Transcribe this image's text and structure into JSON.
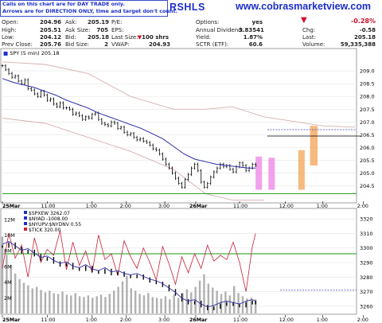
{
  "callout": {
    "line1": "Calls on this chart are for DAY TRADE only.",
    "line2": "Arrows are for DIRECTION ONLY, time and target don't count."
  },
  "ticker": "RSHLS",
  "site": "www.cobrasmarketview.com",
  "quote": {
    "open_label": "Open:",
    "open": "204.96",
    "high_label": "High:",
    "high": "205.51",
    "low_label": "Low:",
    "low": "204.12",
    "prev_label": "Prev Close:",
    "prev": "205.76",
    "ask_label": "Ask:",
    "ask": "205.19",
    "asksize_label": "Ask Size:",
    "asksize": "705",
    "bid_label": "Bid:",
    "bid": "205.18",
    "bidsize_label": "Bid Size:",
    "bidsize": "2",
    "pe_label": "P/E:",
    "eps_label": "EPS:",
    "lastsize_label": "Last Size:",
    "lastsize": "100 shrs",
    "vwap_label": "VWAP:",
    "vwap": "204.93",
    "options_label": "Options:",
    "options": "yes",
    "annualdiv_label": "Annual Dividend:",
    "annualdiv": "3.83541",
    "yield_label": "Yield:",
    "yield": "1.87%",
    "sctr_label": "SCTR (ETF):",
    "sctr": "60.6",
    "changepct": "-0.28%",
    "chg_label": "Chg:",
    "chg": "-0.58",
    "last_label": "Last:",
    "last": "205.18",
    "volume_label": "Volume:",
    "volume": "59,335,388"
  },
  "colors": {
    "price_bar": "#000000",
    "ma_line": "#2c2ca8",
    "envelope": "#d6b0b0",
    "pink_box": "#ee82e6",
    "orange_box": "#f4a860",
    "support": "#1a9a1a",
    "tick_line": "#c8203a",
    "volume_bar": "#b0b0b0",
    "dashed": "#4040c0",
    "brand_blue": "#1d2ec9",
    "down_red": "#d0102a"
  },
  "chart_data": [
    {
      "type": "line",
      "title": "SPY (5 min) 205.18",
      "series": [
        {
          "name": "SPY (5 min) 205.18",
          "x": [
            0,
            3,
            6,
            9,
            12,
            15,
            18,
            21,
            24,
            27,
            30,
            33,
            36,
            39,
            42,
            45,
            48,
            51,
            54,
            57,
            60,
            63,
            66,
            69,
            72,
            75,
            78,
            81,
            84,
            87,
            90,
            93,
            96,
            99,
            102,
            105,
            108,
            111,
            114,
            117,
            120,
            123,
            126,
            129,
            132,
            135,
            138,
            141,
            144,
            147,
            150,
            153,
            156,
            159,
            162,
            165,
            168,
            171,
            174,
            177,
            180,
            183,
            186,
            189,
            192,
            195,
            198,
            201,
            204,
            207,
            210,
            213,
            216,
            219,
            222,
            225,
            228,
            231,
            234,
            237
          ],
          "y": [
            209.2,
            209.05,
            208.9,
            208.75,
            208.8,
            208.6,
            208.5,
            208.65,
            208.3,
            208.25,
            208.1,
            208.0,
            208.2,
            208.05,
            207.85,
            207.9,
            207.7,
            207.6,
            207.75,
            207.55,
            207.55,
            207.5,
            207.3,
            207.35,
            207.25,
            207.1,
            207.2,
            207.15,
            207.3,
            207.35,
            207.1,
            206.95,
            206.9,
            206.85,
            207.0,
            206.95,
            206.75,
            206.8,
            206.6,
            206.5,
            206.55,
            206.4,
            206.3,
            206.35,
            206.25,
            206.2,
            206.1,
            205.95,
            205.9,
            205.75,
            205.55,
            205.35,
            205.2,
            205.0,
            204.8,
            204.6,
            204.45,
            204.75,
            204.95,
            205.2,
            205.35,
            205.1,
            204.65,
            204.45,
            204.6,
            204.85,
            205.05,
            205.2,
            205.35,
            205.25,
            205.3,
            205.15,
            205.05,
            205.25,
            205.4,
            205.3,
            205.1,
            205.2,
            205.35,
            205.3
          ]
        },
        {
          "name": "moving average",
          "x": [
            0,
            10,
            20,
            30,
            40,
            50,
            60,
            70,
            80,
            90,
            100,
            110,
            120,
            130,
            140,
            150,
            160,
            170,
            180,
            190,
            200,
            210,
            220,
            230,
            237
          ],
          "y": [
            208.7,
            208.55,
            208.45,
            208.35,
            208.2,
            208.05,
            207.85,
            207.7,
            207.55,
            207.35,
            207.2,
            207.05,
            206.9,
            206.75,
            206.55,
            206.35,
            206.05,
            205.75,
            205.55,
            205.45,
            205.35,
            205.3,
            205.25,
            205.2,
            205.2
          ]
        }
      ],
      "ylim": [
        203.9,
        209.5
      ],
      "y_ticks": [
        204.5,
        205.0,
        205.5,
        206.0,
        206.5,
        207.0,
        207.5,
        208.0,
        208.5,
        209.0
      ],
      "x_tick_labels": [
        "25Mar",
        "11:00",
        "1:00",
        "2:00",
        "3:00",
        "26Mar",
        "11:00",
        "12:00",
        "1:00",
        "2:00",
        "3:00"
      ],
      "support_level": 204.2,
      "resistance_level": 206.45,
      "dashed_level": 206.7
    },
    {
      "type": "line",
      "legend": [
        "$SPXEW 3262.07",
        "$NYAD -1008.00",
        "$NYUPV:$NYDNV 0.55",
        "$TICK 320.00"
      ],
      "left_axis_ticks": [
        "2M",
        "4M",
        "6M",
        "8M",
        "10M",
        "12M"
      ],
      "right_axis_ticks": [
        "3260",
        "3270",
        "3280",
        "3290",
        "3300",
        "3310",
        "3320"
      ],
      "ylim_right": [
        3255,
        3325
      ],
      "x_tick_labels": [
        "25Mar",
        "11:00",
        "1:00",
        "2:00",
        "3:00",
        "26Mar",
        "11:00",
        "12:00",
        "1:00",
        "2:00",
        "3:00"
      ],
      "series": [
        {
          "name": "$SPXEW 3262.07",
          "x": [
            0,
            6,
            12,
            18,
            24,
            30,
            36,
            42,
            48,
            54,
            60,
            66,
            72,
            78,
            84,
            90,
            96,
            102,
            108,
            114,
            120,
            126,
            132,
            138,
            144,
            150,
            156,
            162,
            168,
            174,
            180,
            186,
            192,
            198,
            204,
            210,
            216,
            222,
            228,
            234,
            237
          ],
          "y": [
            3301,
            3303,
            3300,
            3297,
            3298,
            3295,
            3292,
            3293,
            3290,
            3288,
            3289,
            3286,
            3285,
            3287,
            3284,
            3283,
            3285,
            3282,
            3283,
            3281,
            3280,
            3281,
            3279,
            3277,
            3276,
            3274,
            3271,
            3268,
            3264,
            3262,
            3263,
            3260,
            3258,
            3259,
            3261,
            3262,
            3261,
            3260,
            3262,
            3263,
            3262
          ]
        },
        {
          "name": "$TICK 320.00",
          "x": [
            0,
            6,
            12,
            18,
            24,
            30,
            36,
            42,
            48,
            54,
            60,
            66,
            72,
            78,
            84,
            90,
            96,
            102,
            108,
            114,
            120,
            126,
            132,
            138,
            144,
            150,
            156,
            162,
            168,
            174,
            180,
            186,
            192,
            198,
            204,
            210,
            216,
            222,
            228,
            234,
            237
          ],
          "y": [
            3286,
            3310,
            3293,
            3302,
            3280,
            3307,
            3290,
            3299,
            3295,
            3312,
            3285,
            3304,
            3288,
            3298,
            3283,
            3309,
            3292,
            3296,
            3281,
            3305,
            3294,
            3286,
            3300,
            3290,
            3278,
            3301,
            3289,
            3275,
            3294,
            3283,
            3296,
            3286,
            3302,
            3291,
            3295,
            3292,
            3304,
            3290,
            3270,
            3301,
            3310
          ]
        }
      ],
      "volume_M": [
        9.8,
        7.5,
        6.2,
        5.1,
        4.4,
        3.9,
        3.6,
        3.2,
        3.4,
        3.0,
        2.7,
        2.9,
        2.6,
        2.5,
        2.8,
        2.4,
        2.3,
        2.6,
        2.2,
        2.1,
        2.3,
        2.0,
        2.2,
        2.4,
        2.1,
        2.5,
        2.9,
        3.4,
        4.1,
        4.8,
        3.2,
        2.9,
        2.5,
        2.3,
        2.6,
        2.1,
        2.0,
        1.9,
        2.2,
        1.8,
        2.4,
        2.0,
        2.6,
        3.1,
        2.7,
        3.4,
        4.2,
        5.0,
        3.8,
        3.3,
        2.9,
        2.5,
        2.8,
        2.3,
        3.5,
        2.6,
        2.2,
        1.9,
        2.0,
        1.8
      ],
      "support_level": 3296,
      "dashed_level": 3271
    }
  ]
}
